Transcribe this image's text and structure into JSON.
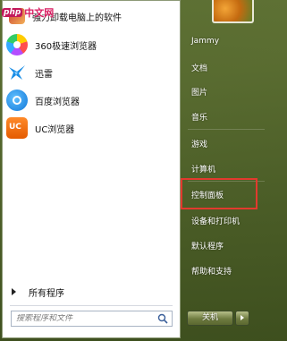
{
  "watermark": {
    "brand": "php",
    "site": "中文网"
  },
  "left_pane": {
    "pinned": [
      {
        "label": "强力卸载电脑上的软件",
        "icon": "uninstall-tool-icon"
      },
      {
        "label": "360极速浏览器",
        "icon": "360-browser-icon"
      },
      {
        "label": "迅雷",
        "icon": "xunlei-icon"
      },
      {
        "label": "百度浏览器",
        "icon": "baidu-browser-icon"
      },
      {
        "label": "UC浏览器",
        "icon": "uc-browser-icon"
      }
    ],
    "all_programs": "所有程序",
    "search_placeholder": "搜索程序和文件"
  },
  "right_pane": {
    "items": [
      {
        "label": "Jammy"
      },
      {
        "label": "文档"
      },
      {
        "label": "图片"
      },
      {
        "label": "音乐"
      },
      {
        "label": "游戏"
      },
      {
        "label": "计算机"
      },
      {
        "label": "控制面板"
      },
      {
        "label": "设备和打印机"
      },
      {
        "label": "默认程序"
      },
      {
        "label": "帮助和支持"
      }
    ],
    "shutdown_label": "关机"
  },
  "colors": {
    "highlight": "#e23a2e",
    "theme": "#6f7a3c"
  }
}
